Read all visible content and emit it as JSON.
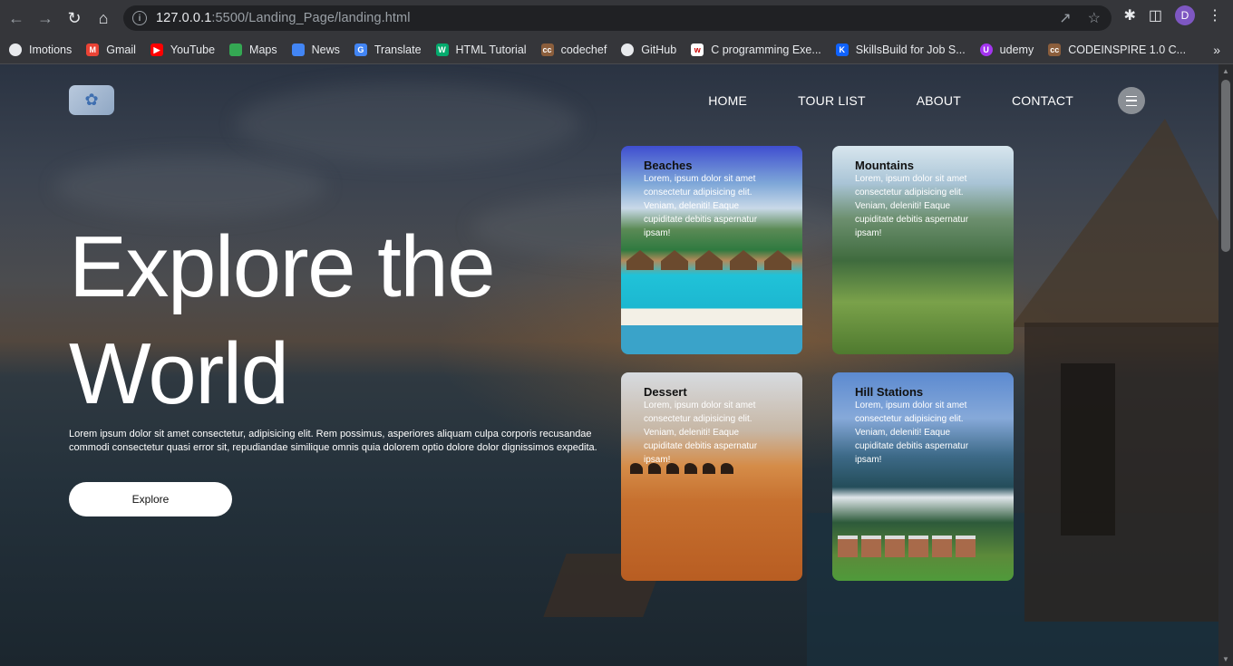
{
  "browser": {
    "url_host": "127.0.0.1",
    "url_path": ":5500/Landing_Page/landing.html",
    "avatar_letter": "D",
    "bookmarks": [
      {
        "label": "Imotions",
        "icon": "globe-icon",
        "color": "#e8eaed"
      },
      {
        "label": "Gmail",
        "icon": "gmail-icon",
        "color": "#ea4335"
      },
      {
        "label": "YouTube",
        "icon": "youtube-icon",
        "color": "#ff0000"
      },
      {
        "label": "Maps",
        "icon": "maps-icon",
        "color": "#34a853"
      },
      {
        "label": "News",
        "icon": "news-icon",
        "color": "#4285f4"
      },
      {
        "label": "Translate",
        "icon": "translate-icon",
        "color": "#4285f4"
      },
      {
        "label": "HTML Tutorial",
        "icon": "w3schools-icon",
        "color": "#04aa6d"
      },
      {
        "label": "codechef",
        "icon": "codechef-icon",
        "color": "#8b5e3c"
      },
      {
        "label": "GitHub",
        "icon": "github-icon",
        "color": "#e8eaed"
      },
      {
        "label": "C programming Exe...",
        "icon": "w3resource-icon",
        "color": "#ffffff"
      },
      {
        "label": "SkillsBuild for Job S...",
        "icon": "skillsbuild-icon",
        "color": "#0f62fe"
      },
      {
        "label": "udemy",
        "icon": "udemy-icon",
        "color": "#a435f0"
      },
      {
        "label": "CODEINSPIRE 1.0 C...",
        "icon": "codeinspire-icon",
        "color": "#8b5e3c"
      }
    ]
  },
  "nav": {
    "items": [
      "HOME",
      "TOUR LIST",
      "ABOUT",
      "CONTACT"
    ]
  },
  "hero": {
    "title_line1": "Explore the",
    "title_line2": "World",
    "text": "Lorem ipsum dolor sit amet consectetur, adipisicing elit. Rem possimus, asperiores aliquam culpa corporis recusandae commodi consectetur quasi error sit, repudiandae similique omnis quia dolorem optio dolore dolor dignissimos expedita.",
    "button": "Explore"
  },
  "cards": [
    {
      "title": "Beaches",
      "desc": "Lorem, ipsum dolor sit amet consectetur adipisicing elit. Veniam, deleniti! Eaque cupiditate debitis aspernatur ipsam!"
    },
    {
      "title": "Mountains",
      "desc": "Lorem, ipsum dolor sit amet consectetur adipisicing elit. Veniam, deleniti! Eaque cupiditate debitis aspernatur ipsam!"
    },
    {
      "title": "Dessert",
      "desc": "Lorem, ipsum dolor sit amet consectetur adipisicing elit. Veniam, deleniti! Eaque cupiditate debitis aspernatur ipsam!"
    },
    {
      "title": "Hill Stations",
      "desc": "Lorem, ipsum dolor sit amet consectetur adipisicing elit. Veniam, deleniti! Eaque cupiditate debitis aspernatur ipsam!"
    }
  ]
}
